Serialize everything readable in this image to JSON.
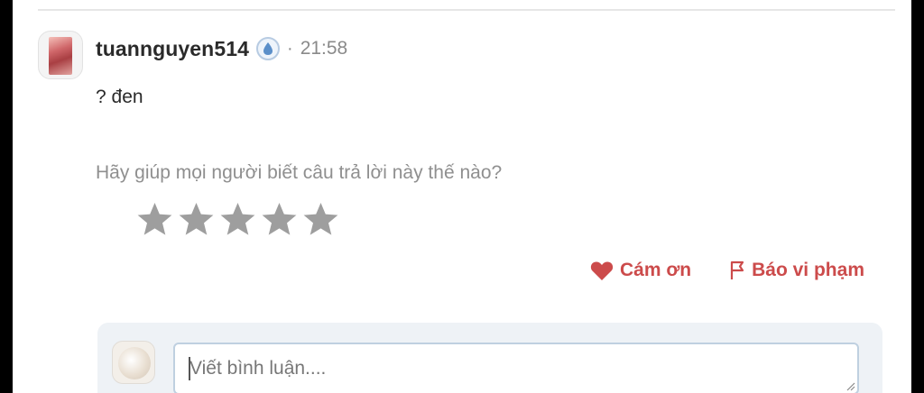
{
  "comment": {
    "username": "tuannguyen514",
    "separator": "·",
    "time": "21:58",
    "answer_text": "? đen",
    "rank_icon": "water-drop-rank-icon"
  },
  "rating": {
    "prompt": "Hãy giúp mọi người biết câu trả lời này thế nào?",
    "max_stars": 5,
    "selected_stars": 0,
    "star_color": "#9e9e9e"
  },
  "actions": {
    "thanks_label": "Cám ơn",
    "report_label": "Báo vi phạm",
    "accent_color": "#cc4b4b"
  },
  "comment_input": {
    "placeholder": "Viết bình luận...."
  }
}
